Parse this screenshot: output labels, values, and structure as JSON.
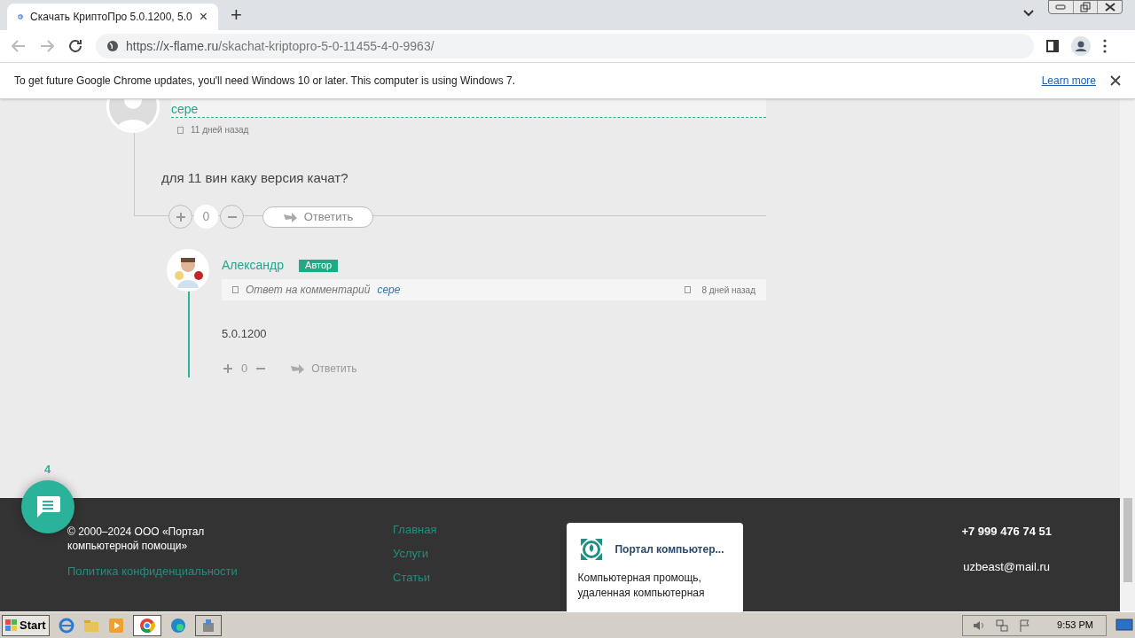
{
  "browser": {
    "tab": {
      "title": "Скачать КриптоПро 5.0.1200, 5.0",
      "close": "×"
    },
    "new_tab": "+",
    "url": {
      "host": "https://x-flame.ru",
      "path": "/skachat-kriptopro-5-0-11455-4-0-9963/"
    }
  },
  "infobar": {
    "message": "To get future Google Chrome updates, you'll need Windows 10 or later. This computer is using Windows 7.",
    "link": "Learn more"
  },
  "comment": {
    "author": "сере",
    "date": "11 дней назад",
    "text": "для 11 вин каку версия качат?",
    "votes": "0",
    "reply": "Ответить"
  },
  "reply": {
    "author": "Александр",
    "badge": "Автор",
    "reply_to_label": "Ответ на комментарий",
    "reply_to": "сере",
    "date": "8 дней назад",
    "text": "5.0.1200",
    "votes": "0",
    "reply": "Ответить"
  },
  "chat_button": {
    "count": "4"
  },
  "footer": {
    "copyright": "© 2000–2024 ООО «Портал компьютерной помощи»",
    "privacy": "Политика конфиденциальности",
    "nav": [
      {
        "label": "Главная"
      },
      {
        "label": "Услуги"
      },
      {
        "label": "Статьи"
      }
    ],
    "card": {
      "title": "Портал компьютер...",
      "text": "Компьютерная промощь, удаленная компьютерная"
    },
    "phone": "+7 999 476 74 51",
    "email": "uzbeast@mail.ru"
  },
  "taskbar": {
    "start": "Start",
    "time": "9:53 PM"
  }
}
